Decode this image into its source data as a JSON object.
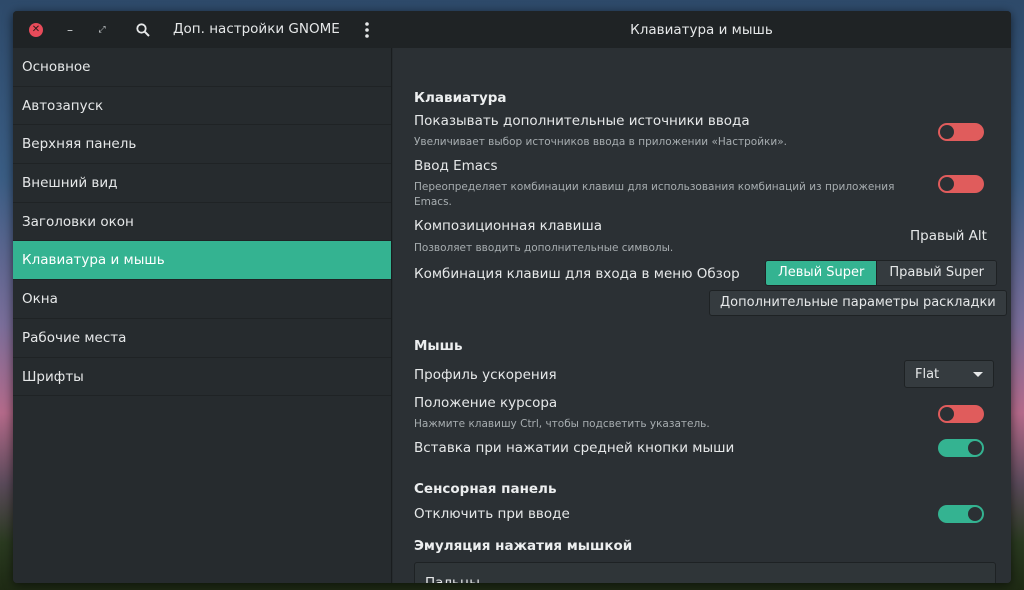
{
  "window": {
    "app_title": "Доп. настройки GNOME",
    "page_title": "Клавиатура и мышь"
  },
  "icons": {
    "close": "close-icon",
    "minimize": "minimize-icon",
    "maximize": "maximize-icon",
    "search": "search-icon",
    "menu": "kebab-menu-icon"
  },
  "sidebar": {
    "items": [
      {
        "label": "Основное"
      },
      {
        "label": "Автозапуск"
      },
      {
        "label": "Верхняя панель"
      },
      {
        "label": "Внешний вид"
      },
      {
        "label": "Заголовки окон"
      },
      {
        "label": "Клавиатура и мышь",
        "active": true
      },
      {
        "label": "Окна"
      },
      {
        "label": "Рабочие места"
      },
      {
        "label": "Шрифты"
      }
    ]
  },
  "keyboard": {
    "title": "Клавиатура",
    "extra_sources": {
      "label": "Показывать дополнительные источники ввода",
      "desc": "Увеличивает выбор источников ввода в приложении «Настройки».",
      "enabled": false
    },
    "emacs": {
      "label": "Ввод Emacs",
      "desc": "Переопределяет комбинации клавиш для использования комбинаций из приложения Emacs.",
      "enabled": false
    },
    "compose": {
      "label": "Композиционная клавиша",
      "desc": "Позволяет вводить дополнительные символы.",
      "value": "Правый Alt"
    },
    "overview": {
      "label": "Комбинация клавиш для входа в меню Обзор",
      "options": [
        "Левый Super",
        "Правый Super"
      ],
      "selected": "Левый Super"
    },
    "layout_button": "Дополнительные параметры раскладки"
  },
  "mouse": {
    "title": "Мышь",
    "accel_profile": {
      "label": "Профиль ускорения",
      "value": "Flat"
    },
    "pointer_location": {
      "label": "Положение курсора",
      "desc": "Нажмите клавишу Ctrl, чтобы подсветить указатель.",
      "enabled": false
    },
    "middle_click_paste": {
      "label": "Вставка при нажатии средней кнопки мыши",
      "enabled": true
    }
  },
  "touchpad": {
    "title": "Сенсорная панель",
    "disable_while_typing": {
      "label": "Отключить при вводе",
      "enabled": true
    },
    "click_emulation_title": "Эмуляция нажатия мышкой",
    "click_emulation_option": "Пальцы"
  },
  "colors": {
    "accent": "#34b391",
    "switch_off": "#e05c5c",
    "close_button": "#e84b5a",
    "window_bg": "#2b3034",
    "sidebar_bg": "#262b2e"
  }
}
